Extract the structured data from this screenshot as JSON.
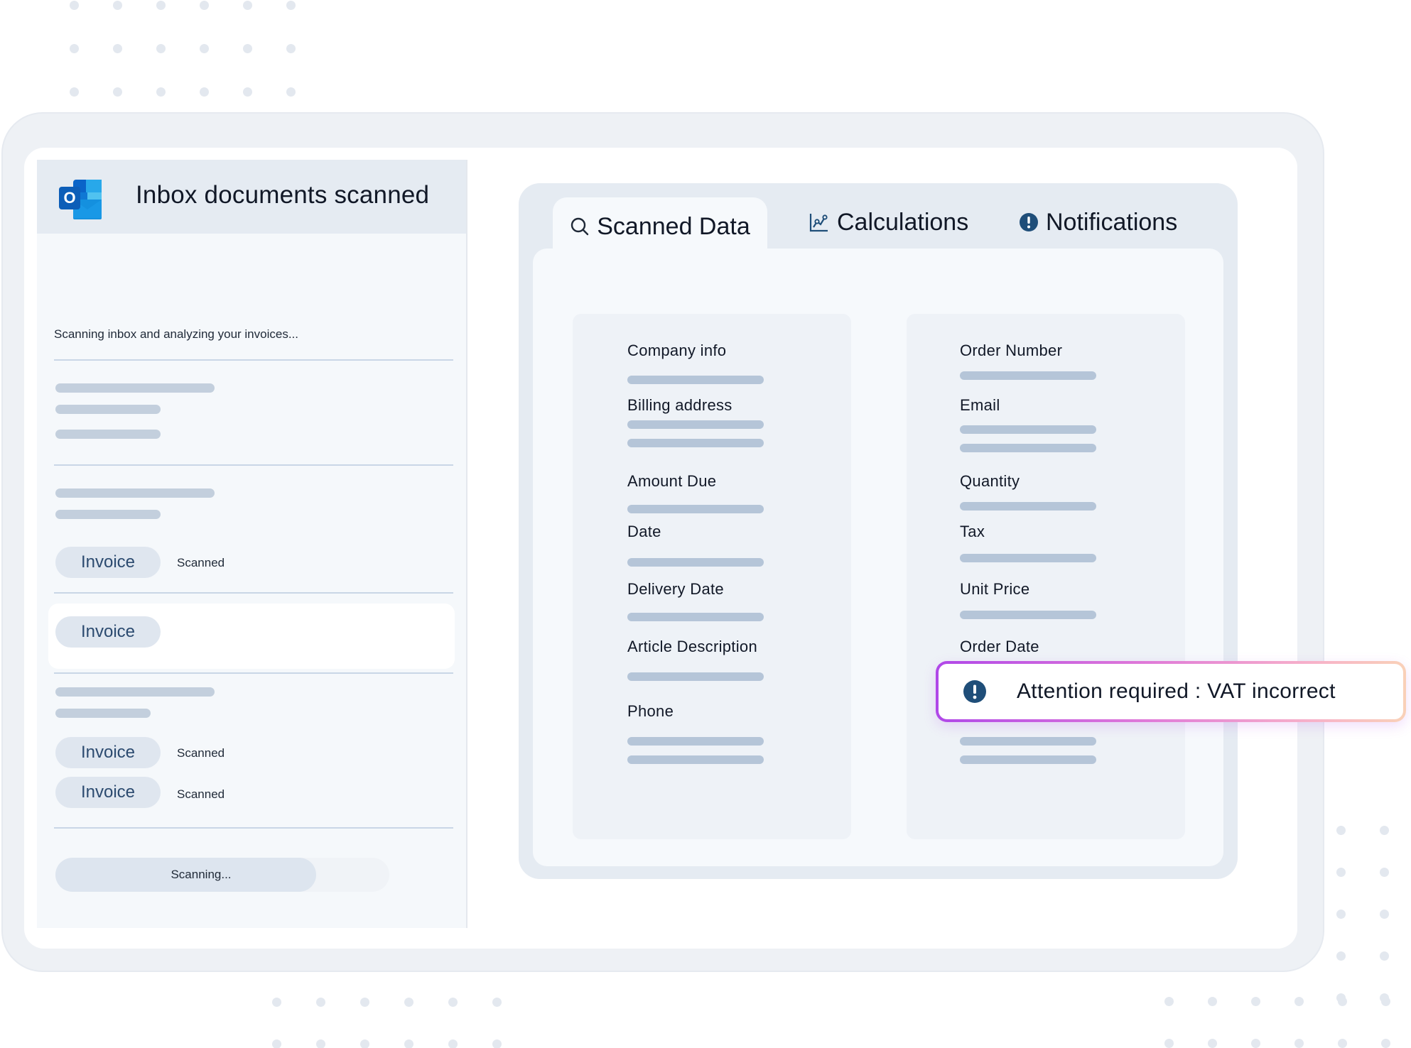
{
  "left": {
    "app_icon": "outlook-icon",
    "title": "Inbox documents scanned",
    "status": "Scanning inbox and analyzing your invoices...",
    "rows": [
      {
        "chip": "Invoice",
        "status": "Scanned"
      },
      {
        "chip": "Invoice"
      },
      {
        "chip": "Invoice",
        "status": "Scanned"
      },
      {
        "chip": "Invoice",
        "status": "Scanned"
      }
    ],
    "progress": {
      "label": "Scanning...",
      "percent": 78
    }
  },
  "tabs": [
    {
      "label": "Scanned Data",
      "icon": "search-icon",
      "active": true
    },
    {
      "label": "Calculations",
      "icon": "chart-icon"
    },
    {
      "label": "Notifications",
      "icon": "alert-icon"
    }
  ],
  "fields_left": [
    "Company info",
    "Billing address",
    "Amount Due",
    "Date",
    "Delivery Date",
    "Article Description",
    "Phone"
  ],
  "fields_right": [
    "Order Number",
    "Email",
    "Quantity",
    "Tax",
    "Unit Price",
    "Order Date"
  ],
  "alert": {
    "icon": "exclamation-icon",
    "text": "Attention required : VAT incorrect"
  },
  "colors": {
    "accent_dark": "#1f4e79",
    "skeleton": "#b5c5d8",
    "alert_gradient_start": "#b047e8",
    "alert_gradient_end": "#f9d1b8"
  }
}
